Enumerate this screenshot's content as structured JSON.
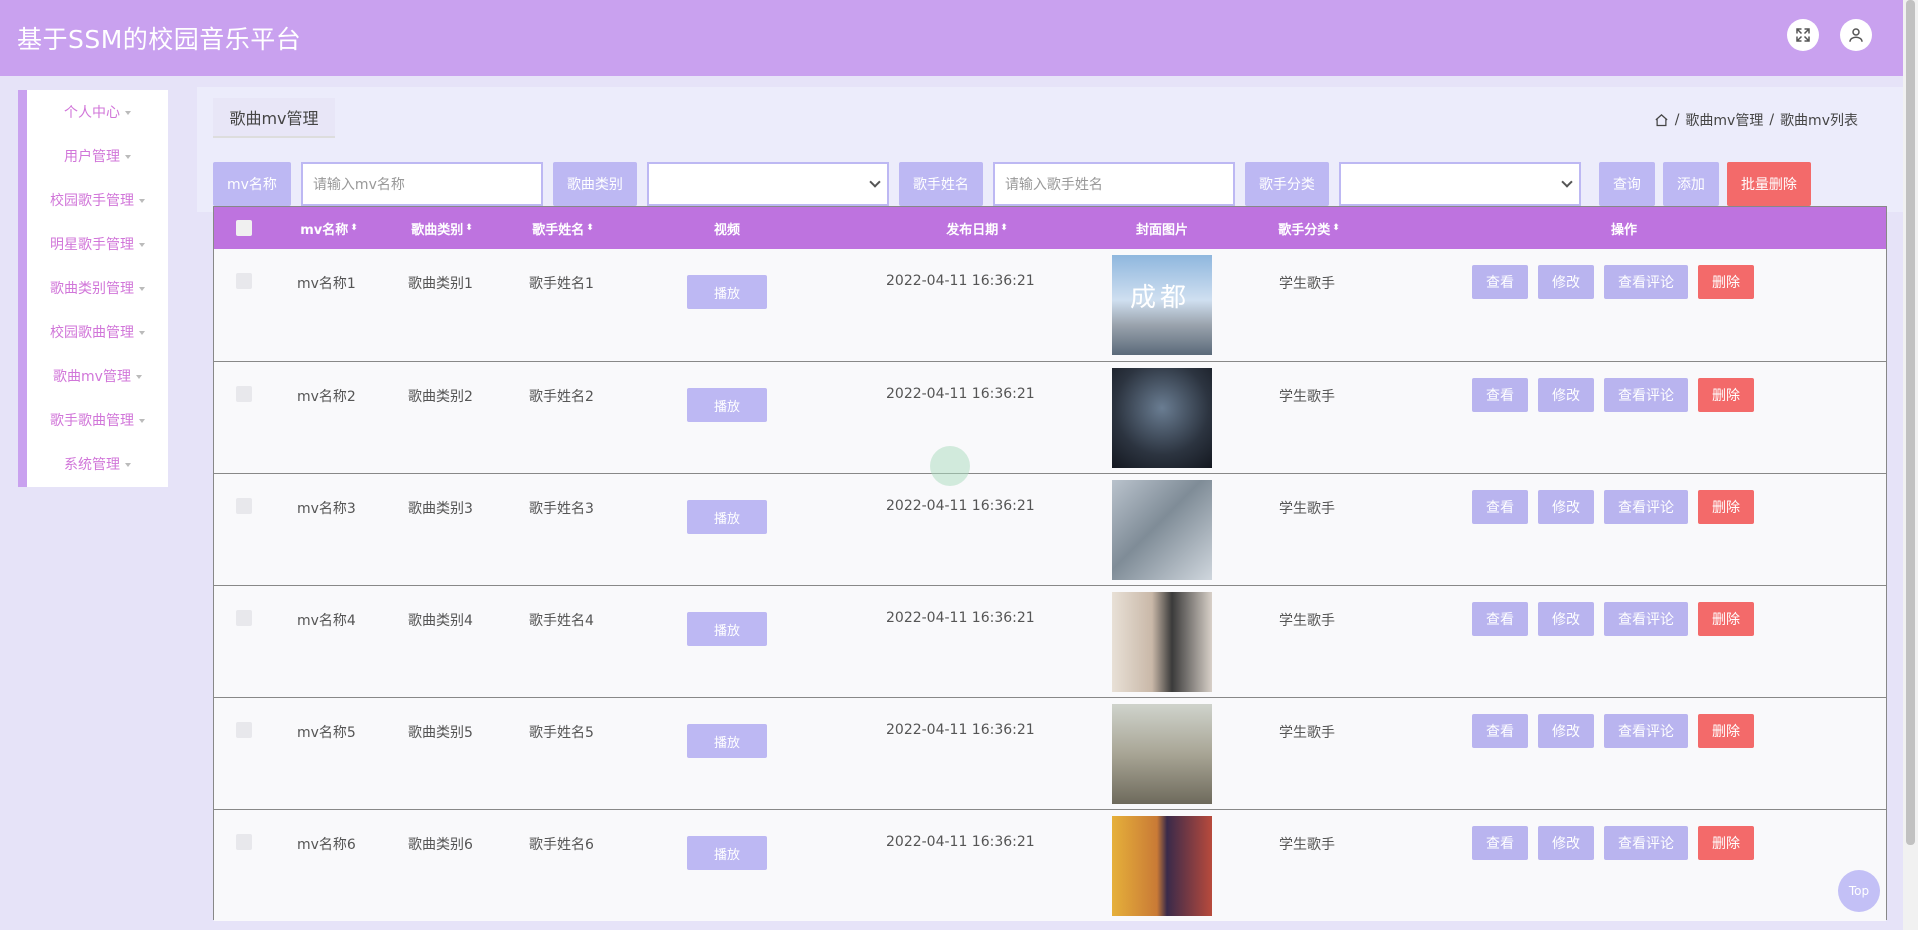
{
  "header": {
    "title": "基于SSM的校园音乐平台"
  },
  "sidebar": {
    "items": [
      {
        "label": "个人中心"
      },
      {
        "label": "用户管理"
      },
      {
        "label": "校园歌手管理"
      },
      {
        "label": "明星歌手管理"
      },
      {
        "label": "歌曲类别管理"
      },
      {
        "label": "校园歌曲管理"
      },
      {
        "label": "歌曲mv管理"
      },
      {
        "label": "歌手歌曲管理"
      },
      {
        "label": "系统管理"
      }
    ]
  },
  "page": {
    "tab": "歌曲mv管理",
    "breadcrumb": [
      "歌曲mv管理",
      "歌曲mv列表"
    ]
  },
  "filter": {
    "mv_label": "mv名称",
    "mv_placeholder": "请输入mv名称",
    "category_label": "歌曲类别",
    "singer_label": "歌手姓名",
    "singer_placeholder": "请输入歌手姓名",
    "singer_type_label": "歌手分类",
    "query": "查询",
    "add": "添加",
    "batch_delete": "批量删除"
  },
  "table": {
    "headers": {
      "mv_name": "mv名称",
      "category": "歌曲类别",
      "singer": "歌手姓名",
      "video": "视频",
      "date": "发布日期",
      "cover": "封面图片",
      "singer_type": "歌手分类",
      "ops": "操作"
    },
    "sort_glyph": "⬍",
    "play_label": "播放",
    "actions": {
      "view": "查看",
      "edit": "修改",
      "comments": "查看评论",
      "delete": "删除"
    },
    "rows": [
      {
        "mv": "mv名称1",
        "category": "歌曲类别1",
        "singer": "歌手姓名1",
        "date": "2022-04-11 16:36:21",
        "type": "学生歌手",
        "cover_text": "成都"
      },
      {
        "mv": "mv名称2",
        "category": "歌曲类别2",
        "singer": "歌手姓名2",
        "date": "2022-04-11 16:36:21",
        "type": "学生歌手",
        "cover_text": ""
      },
      {
        "mv": "mv名称3",
        "category": "歌曲类别3",
        "singer": "歌手姓名3",
        "date": "2022-04-11 16:36:21",
        "type": "学生歌手",
        "cover_text": ""
      },
      {
        "mv": "mv名称4",
        "category": "歌曲类别4",
        "singer": "歌手姓名4",
        "date": "2022-04-11 16:36:21",
        "type": "学生歌手",
        "cover_text": ""
      },
      {
        "mv": "mv名称5",
        "category": "歌曲类别5",
        "singer": "歌手姓名5",
        "date": "2022-04-11 16:36:21",
        "type": "学生歌手",
        "cover_text": ""
      },
      {
        "mv": "mv名称6",
        "category": "歌曲类别6",
        "singer": "歌手姓名6",
        "date": "2022-04-11 16:36:21",
        "type": "学生歌手",
        "cover_text": ""
      }
    ]
  },
  "top_button": "Top",
  "colors": {
    "header": "#c9a1ef",
    "table_header": "#be73df",
    "button": "#bdb8f3",
    "danger": "#f36a6a",
    "sidebar_text": "#d176d9"
  }
}
